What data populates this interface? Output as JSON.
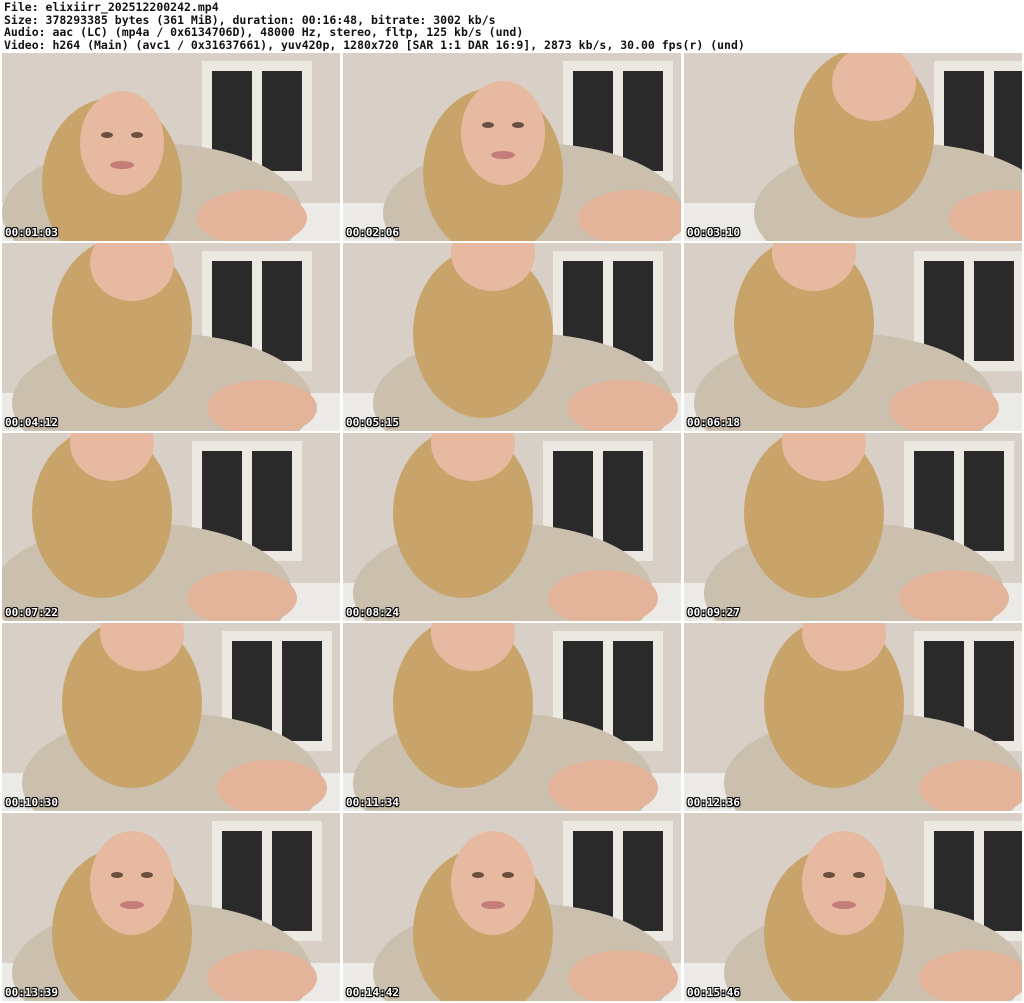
{
  "header": {
    "file_line": "File: elixiirr_202512200242.mp4",
    "size_line": "Size: 378293385 bytes (361 MiB), duration: 00:16:48, bitrate: 3002 kb/s",
    "audio_line": "Audio: aac (LC) (mp4a / 0x6134706D), 48000 Hz, stereo, fltp, 125 kb/s (und)",
    "video_line": "Video: h264 (Main) (avc1 / 0x31637661), yuv420p, 1280x720 [SAR 1:1 DAR 16:9], 2873 kb/s, 30.00 fps(r) (und)"
  },
  "thumbnails": [
    {
      "timestamp": "00:01:03"
    },
    {
      "timestamp": "00:02:06"
    },
    {
      "timestamp": "00:03:10"
    },
    {
      "timestamp": "00:04:12"
    },
    {
      "timestamp": "00:05:15"
    },
    {
      "timestamp": "00:06:18"
    },
    {
      "timestamp": "00:07:22"
    },
    {
      "timestamp": "00:08:24"
    },
    {
      "timestamp": "00:09:27"
    },
    {
      "timestamp": "00:10:30"
    },
    {
      "timestamp": "00:11:34"
    },
    {
      "timestamp": "00:12:36"
    },
    {
      "timestamp": "00:13:39"
    },
    {
      "timestamp": "00:14:42"
    },
    {
      "timestamp": "00:15:46"
    }
  ],
  "colors": {
    "timestamp_text": "#ffffff",
    "header_text": "#111111",
    "background": "#ffffff"
  }
}
